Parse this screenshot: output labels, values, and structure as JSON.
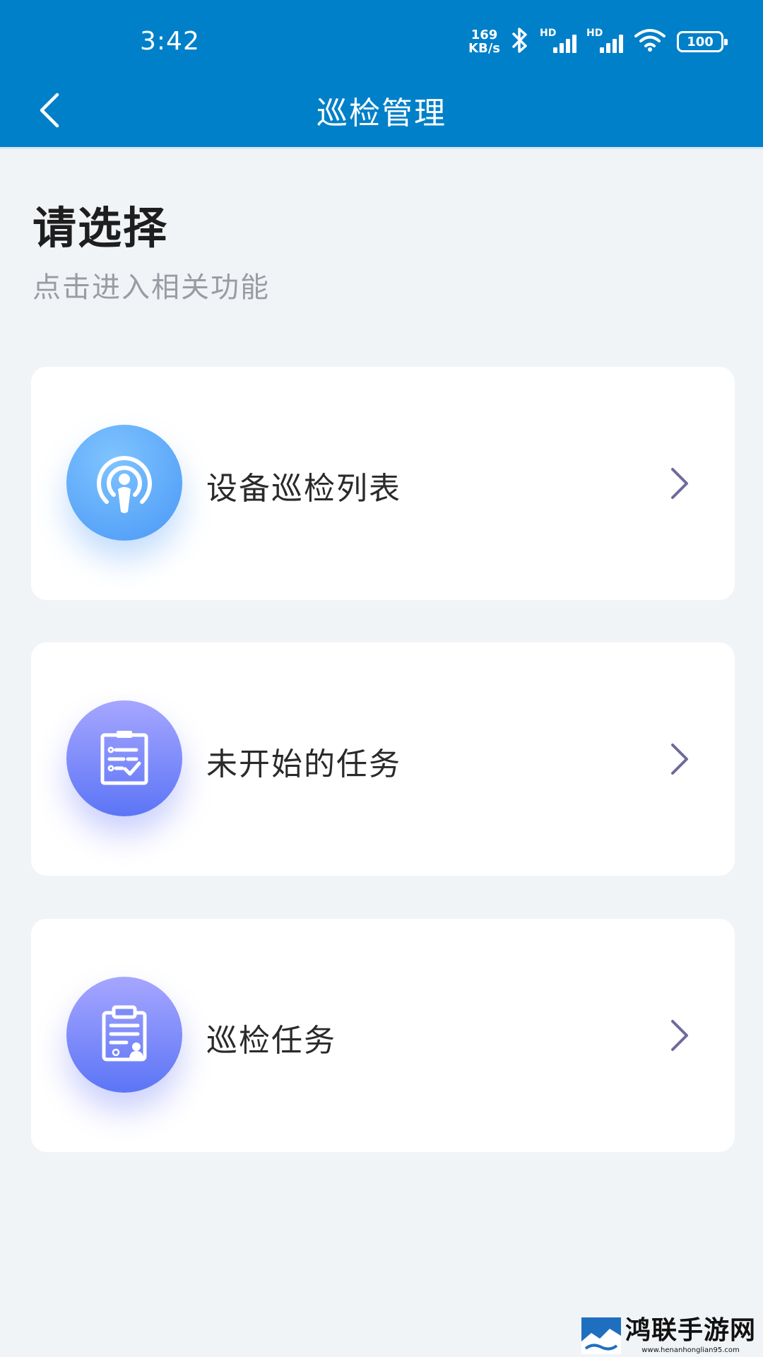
{
  "status_bar": {
    "time": "3:42",
    "net_speed_value": "169",
    "net_speed_unit": "KB/s",
    "sim1_label": "HD",
    "sim2_label": "HD",
    "battery": "100",
    "icons": [
      "bluetooth-icon",
      "signal-icon",
      "signal-icon",
      "wifi-icon",
      "battery-icon"
    ]
  },
  "nav": {
    "title": "巡检管理",
    "back_icon": "chevron-left-icon"
  },
  "intro": {
    "title": "请选择",
    "subtitle": "点击进入相关功能"
  },
  "cards": [
    {
      "label": "设备巡检列表",
      "icon": "broadcast-person-icon",
      "color": "#4a98f6"
    },
    {
      "label": "未开始的任务",
      "icon": "checklist-icon",
      "color": "#6a7ef7"
    },
    {
      "label": "巡检任务",
      "icon": "clipboard-user-icon",
      "color": "#6a7ef7"
    }
  ],
  "colors": {
    "header": "#0080c9",
    "background": "#f1f4f7",
    "chevron": "#6e6a9a"
  },
  "watermark": {
    "title": "鸿联手游网",
    "url": "www.henanhonglian95.com"
  }
}
